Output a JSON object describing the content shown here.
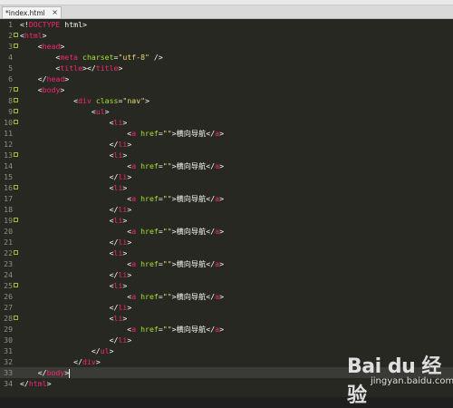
{
  "tab": {
    "title": "*index.html",
    "close": "×"
  },
  "lines": [
    [
      {
        "c": "p",
        "v": "<!"
      },
      {
        "c": "t",
        "v": "DOCTYPE"
      },
      {
        "c": "p",
        "v": " html>"
      }
    ],
    [
      {
        "c": "p",
        "v": "<"
      },
      {
        "c": "t",
        "v": "html"
      },
      {
        "c": "p",
        "v": ">"
      }
    ],
    [
      {
        "c": "p",
        "v": "    <"
      },
      {
        "c": "t",
        "v": "head"
      },
      {
        "c": "p",
        "v": ">"
      }
    ],
    [
      {
        "c": "p",
        "v": "        <"
      },
      {
        "c": "t",
        "v": "meta"
      },
      {
        "c": "p",
        "v": " "
      },
      {
        "c": "a",
        "v": "charset"
      },
      {
        "c": "p",
        "v": "="
      },
      {
        "c": "s",
        "v": "\"utf-8\""
      },
      {
        "c": "p",
        "v": " />"
      }
    ],
    [
      {
        "c": "p",
        "v": "        <"
      },
      {
        "c": "t",
        "v": "title"
      },
      {
        "c": "p",
        "v": "></"
      },
      {
        "c": "t",
        "v": "title"
      },
      {
        "c": "p",
        "v": ">"
      }
    ],
    [
      {
        "c": "p",
        "v": "    </"
      },
      {
        "c": "t",
        "v": "head"
      },
      {
        "c": "p",
        "v": ">"
      }
    ],
    [
      {
        "c": "p",
        "v": "    <"
      },
      {
        "c": "t",
        "v": "body"
      },
      {
        "c": "p",
        "v": ">"
      }
    ],
    [
      {
        "c": "p",
        "v": "            <"
      },
      {
        "c": "t",
        "v": "div"
      },
      {
        "c": "p",
        "v": " "
      },
      {
        "c": "a",
        "v": "class"
      },
      {
        "c": "p",
        "v": "="
      },
      {
        "c": "s",
        "v": "\"nav\""
      },
      {
        "c": "p",
        "v": ">"
      }
    ],
    [
      {
        "c": "p",
        "v": "                <"
      },
      {
        "c": "t",
        "v": "ul"
      },
      {
        "c": "p",
        "v": ">"
      }
    ],
    [
      {
        "c": "p",
        "v": "                    <"
      },
      {
        "c": "t",
        "v": "li"
      },
      {
        "c": "p",
        "v": ">"
      }
    ],
    [
      {
        "c": "p",
        "v": "                        <"
      },
      {
        "c": "t",
        "v": "a"
      },
      {
        "c": "p",
        "v": " "
      },
      {
        "c": "a",
        "v": "href"
      },
      {
        "c": "p",
        "v": "="
      },
      {
        "c": "s",
        "v": "\"\""
      },
      {
        "c": "p",
        "v": ">横向导航</"
      },
      {
        "c": "t",
        "v": "a"
      },
      {
        "c": "p",
        "v": ">"
      }
    ],
    [
      {
        "c": "p",
        "v": "                    </"
      },
      {
        "c": "t",
        "v": "li"
      },
      {
        "c": "p",
        "v": ">"
      }
    ],
    [
      {
        "c": "p",
        "v": "                    <"
      },
      {
        "c": "t",
        "v": "li"
      },
      {
        "c": "p",
        "v": ">"
      }
    ],
    [
      {
        "c": "p",
        "v": "                        <"
      },
      {
        "c": "t",
        "v": "a"
      },
      {
        "c": "p",
        "v": " "
      },
      {
        "c": "a",
        "v": "href"
      },
      {
        "c": "p",
        "v": "="
      },
      {
        "c": "s",
        "v": "\"\""
      },
      {
        "c": "p",
        "v": ">横向导航</"
      },
      {
        "c": "t",
        "v": "a"
      },
      {
        "c": "p",
        "v": ">"
      }
    ],
    [
      {
        "c": "p",
        "v": "                    </"
      },
      {
        "c": "t",
        "v": "li"
      },
      {
        "c": "p",
        "v": ">"
      }
    ],
    [
      {
        "c": "p",
        "v": "                    <"
      },
      {
        "c": "t",
        "v": "li"
      },
      {
        "c": "p",
        "v": ">"
      }
    ],
    [
      {
        "c": "p",
        "v": "                        <"
      },
      {
        "c": "t",
        "v": "a"
      },
      {
        "c": "p",
        "v": " "
      },
      {
        "c": "a",
        "v": "href"
      },
      {
        "c": "p",
        "v": "="
      },
      {
        "c": "s",
        "v": "\"\""
      },
      {
        "c": "p",
        "v": ">横向导航</"
      },
      {
        "c": "t",
        "v": "a"
      },
      {
        "c": "p",
        "v": ">"
      }
    ],
    [
      {
        "c": "p",
        "v": "                    </"
      },
      {
        "c": "t",
        "v": "li"
      },
      {
        "c": "p",
        "v": ">"
      }
    ],
    [
      {
        "c": "p",
        "v": "                    <"
      },
      {
        "c": "t",
        "v": "li"
      },
      {
        "c": "p",
        "v": ">"
      }
    ],
    [
      {
        "c": "p",
        "v": "                        <"
      },
      {
        "c": "t",
        "v": "a"
      },
      {
        "c": "p",
        "v": " "
      },
      {
        "c": "a",
        "v": "href"
      },
      {
        "c": "p",
        "v": "="
      },
      {
        "c": "s",
        "v": "\"\""
      },
      {
        "c": "p",
        "v": ">横向导航</"
      },
      {
        "c": "t",
        "v": "a"
      },
      {
        "c": "p",
        "v": ">"
      }
    ],
    [
      {
        "c": "p",
        "v": "                    </"
      },
      {
        "c": "t",
        "v": "li"
      },
      {
        "c": "p",
        "v": ">"
      }
    ],
    [
      {
        "c": "p",
        "v": "                    <"
      },
      {
        "c": "t",
        "v": "li"
      },
      {
        "c": "p",
        "v": ">"
      }
    ],
    [
      {
        "c": "p",
        "v": "                        <"
      },
      {
        "c": "t",
        "v": "a"
      },
      {
        "c": "p",
        "v": " "
      },
      {
        "c": "a",
        "v": "href"
      },
      {
        "c": "p",
        "v": "="
      },
      {
        "c": "s",
        "v": "\"\""
      },
      {
        "c": "p",
        "v": ">横向导航</"
      },
      {
        "c": "t",
        "v": "a"
      },
      {
        "c": "p",
        "v": ">"
      }
    ],
    [
      {
        "c": "p",
        "v": "                    </"
      },
      {
        "c": "t",
        "v": "li"
      },
      {
        "c": "p",
        "v": ">"
      }
    ],
    [
      {
        "c": "p",
        "v": "                    <"
      },
      {
        "c": "t",
        "v": "li"
      },
      {
        "c": "p",
        "v": ">"
      }
    ],
    [
      {
        "c": "p",
        "v": "                        <"
      },
      {
        "c": "t",
        "v": "a"
      },
      {
        "c": "p",
        "v": " "
      },
      {
        "c": "a",
        "v": "href"
      },
      {
        "c": "p",
        "v": "="
      },
      {
        "c": "s",
        "v": "\"\""
      },
      {
        "c": "p",
        "v": ">横向导航</"
      },
      {
        "c": "t",
        "v": "a"
      },
      {
        "c": "p",
        "v": ">"
      }
    ],
    [
      {
        "c": "p",
        "v": "                    </"
      },
      {
        "c": "t",
        "v": "li"
      },
      {
        "c": "p",
        "v": ">"
      }
    ],
    [
      {
        "c": "p",
        "v": "                    <"
      },
      {
        "c": "t",
        "v": "li"
      },
      {
        "c": "p",
        "v": ">"
      }
    ],
    [
      {
        "c": "p",
        "v": "                        <"
      },
      {
        "c": "t",
        "v": "a"
      },
      {
        "c": "p",
        "v": " "
      },
      {
        "c": "a",
        "v": "href"
      },
      {
        "c": "p",
        "v": "="
      },
      {
        "c": "s",
        "v": "\"\""
      },
      {
        "c": "p",
        "v": ">横向导航</"
      },
      {
        "c": "t",
        "v": "a"
      },
      {
        "c": "p",
        "v": ">"
      }
    ],
    [
      {
        "c": "p",
        "v": "                    </"
      },
      {
        "c": "t",
        "v": "li"
      },
      {
        "c": "p",
        "v": ">"
      }
    ],
    [
      {
        "c": "p",
        "v": "                </"
      },
      {
        "c": "t",
        "v": "ul"
      },
      {
        "c": "p",
        "v": ">"
      }
    ],
    [
      {
        "c": "p",
        "v": "            </"
      },
      {
        "c": "t",
        "v": "div"
      },
      {
        "c": "p",
        "v": ">"
      }
    ],
    [
      {
        "c": "p",
        "v": "    </"
      },
      {
        "c": "t",
        "v": "body"
      },
      {
        "c": "p",
        "v": ">"
      }
    ],
    [
      {
        "c": "p",
        "v": "</"
      },
      {
        "c": "t",
        "v": "html"
      },
      {
        "c": "p",
        "v": ">"
      }
    ]
  ],
  "folds": [
    2,
    3,
    7,
    8,
    9,
    10,
    13,
    16,
    19,
    22,
    25,
    28
  ],
  "active_line": 33,
  "watermark": {
    "main": "Bai du 经验",
    "sub": "jingyan.baidu.com"
  }
}
